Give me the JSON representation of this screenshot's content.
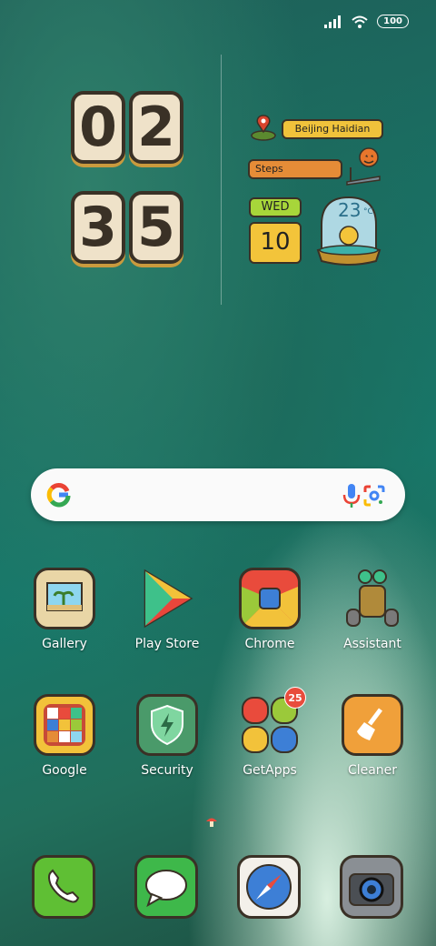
{
  "status_bar": {
    "battery": "100"
  },
  "clock": {
    "h1": "0",
    "h2": "2",
    "m1": "3",
    "m2": "5"
  },
  "widget": {
    "location": "Beijing Haidian",
    "steps_label": "Steps",
    "day": "WED",
    "date": "10",
    "temperature": "23",
    "temp_unit": "°C"
  },
  "search": {},
  "apps": [
    {
      "label": "Gallery"
    },
    {
      "label": "Play Store"
    },
    {
      "label": "Chrome"
    },
    {
      "label": "Assistant"
    },
    {
      "label": "Google"
    },
    {
      "label": "Security"
    },
    {
      "label": "GetApps",
      "badge": "25"
    },
    {
      "label": "Cleaner"
    }
  ],
  "dock": [
    {
      "icon": "phone-icon"
    },
    {
      "icon": "messages-icon"
    },
    {
      "icon": "browser-compass-icon"
    },
    {
      "icon": "camera-icon"
    }
  ]
}
